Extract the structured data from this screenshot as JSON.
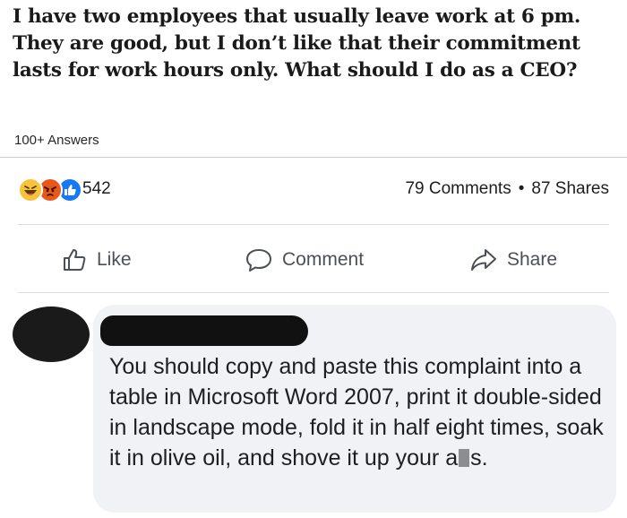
{
  "question": {
    "title": "I have two employees that usually leave work at 6 pm. They are good, but I don’t like that their commitment lasts for work hours only. What should I do as a CEO?",
    "answers_count": "100+ Answers"
  },
  "stats": {
    "reaction_count": "542",
    "reactions": [
      "haha-icon",
      "angry-icon",
      "like-icon"
    ],
    "comments": "79 Comments",
    "separator": "•",
    "shares": "87 Shares"
  },
  "actions": {
    "like_label": "Like",
    "comment_label": "Comment",
    "share_label": "Share"
  },
  "comment": {
    "text_before": "You should copy and paste this complaint into a table in Microsoft Word 2007, print it double-sided in landscape mode, fold it in half eight times, soak it in olive oil, and shove it up your a",
    "text_after": "s."
  },
  "colors": {
    "like_blue": "#1877f2",
    "haha_yellow": "#f7c33b",
    "angry_orange": "#e8581c",
    "bubble_bg": "#f0f2f5",
    "action_gray": "#4b4f56"
  }
}
